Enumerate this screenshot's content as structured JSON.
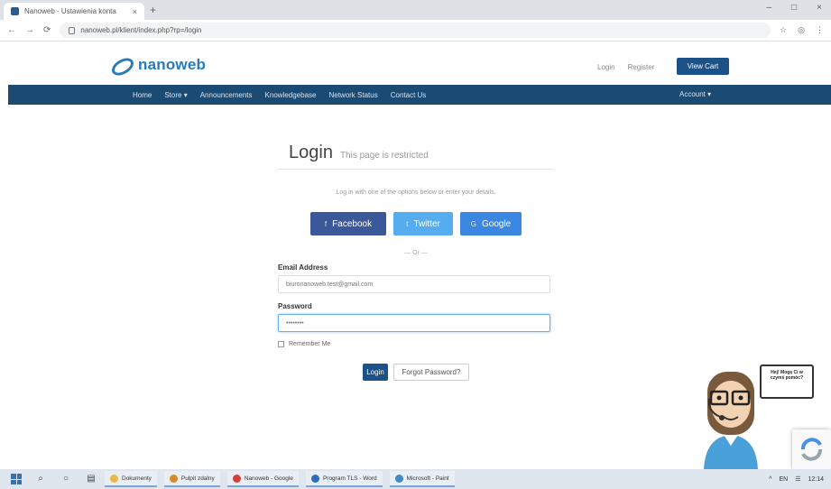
{
  "browser": {
    "tab_title": "Nanoweb - Ustawienia konta",
    "new_tab": "+",
    "window_controls": [
      "–",
      "□",
      "×"
    ],
    "nav_buttons": [
      "←",
      "→",
      "⟳"
    ],
    "url": "nanoweb.pl/klient/index.php?rp=/login",
    "address_icons": [
      "☆",
      "◎",
      "⋮"
    ]
  },
  "header": {
    "logo_main": "nanoweb",
    "logo_accent": "",
    "links": [
      "Login",
      "Register"
    ],
    "cart_label": "View Cart"
  },
  "nav": {
    "items": [
      "Home",
      "Store ▾",
      "Announcements",
      "Knowledgebase",
      "Network Status",
      "Contact Us"
    ],
    "right": "Account ▾"
  },
  "login": {
    "title": "Login",
    "subtitle": "This page is restricted",
    "description": "Log in with one of the options below or enter your details.",
    "social": [
      {
        "label": "Facebook",
        "icon": "f"
      },
      {
        "label": "Twitter",
        "icon": "t"
      },
      {
        "label": "Google",
        "icon": "G"
      }
    ],
    "or": "— Or —",
    "email_label": "Email Address",
    "email_value": "biuronanoweb.test@gmail.com",
    "password_label": "Password",
    "password_value": "••••••••",
    "remember_label": "Remember Me",
    "login_button": "Login",
    "forgot_button": "Forgot Password?"
  },
  "mascot": {
    "speech": "Hej! Mogę Ci w czymś pomóc?"
  },
  "taskbar": {
    "apps": [
      {
        "label": "Dokumenty",
        "color": "#e8b948"
      },
      {
        "label": "Pulpit zdalny",
        "color": "#d48a2c"
      },
      {
        "label": "Nanoweb - Google",
        "color": "#d43f3a"
      },
      {
        "label": "Program TLS - Word",
        "color": "#2b6cc4"
      },
      {
        "label": "Microsoft - Paint",
        "color": "#3f8ac7"
      }
    ],
    "tray": [
      "^",
      "EN",
      "☰",
      "12:14"
    ]
  }
}
